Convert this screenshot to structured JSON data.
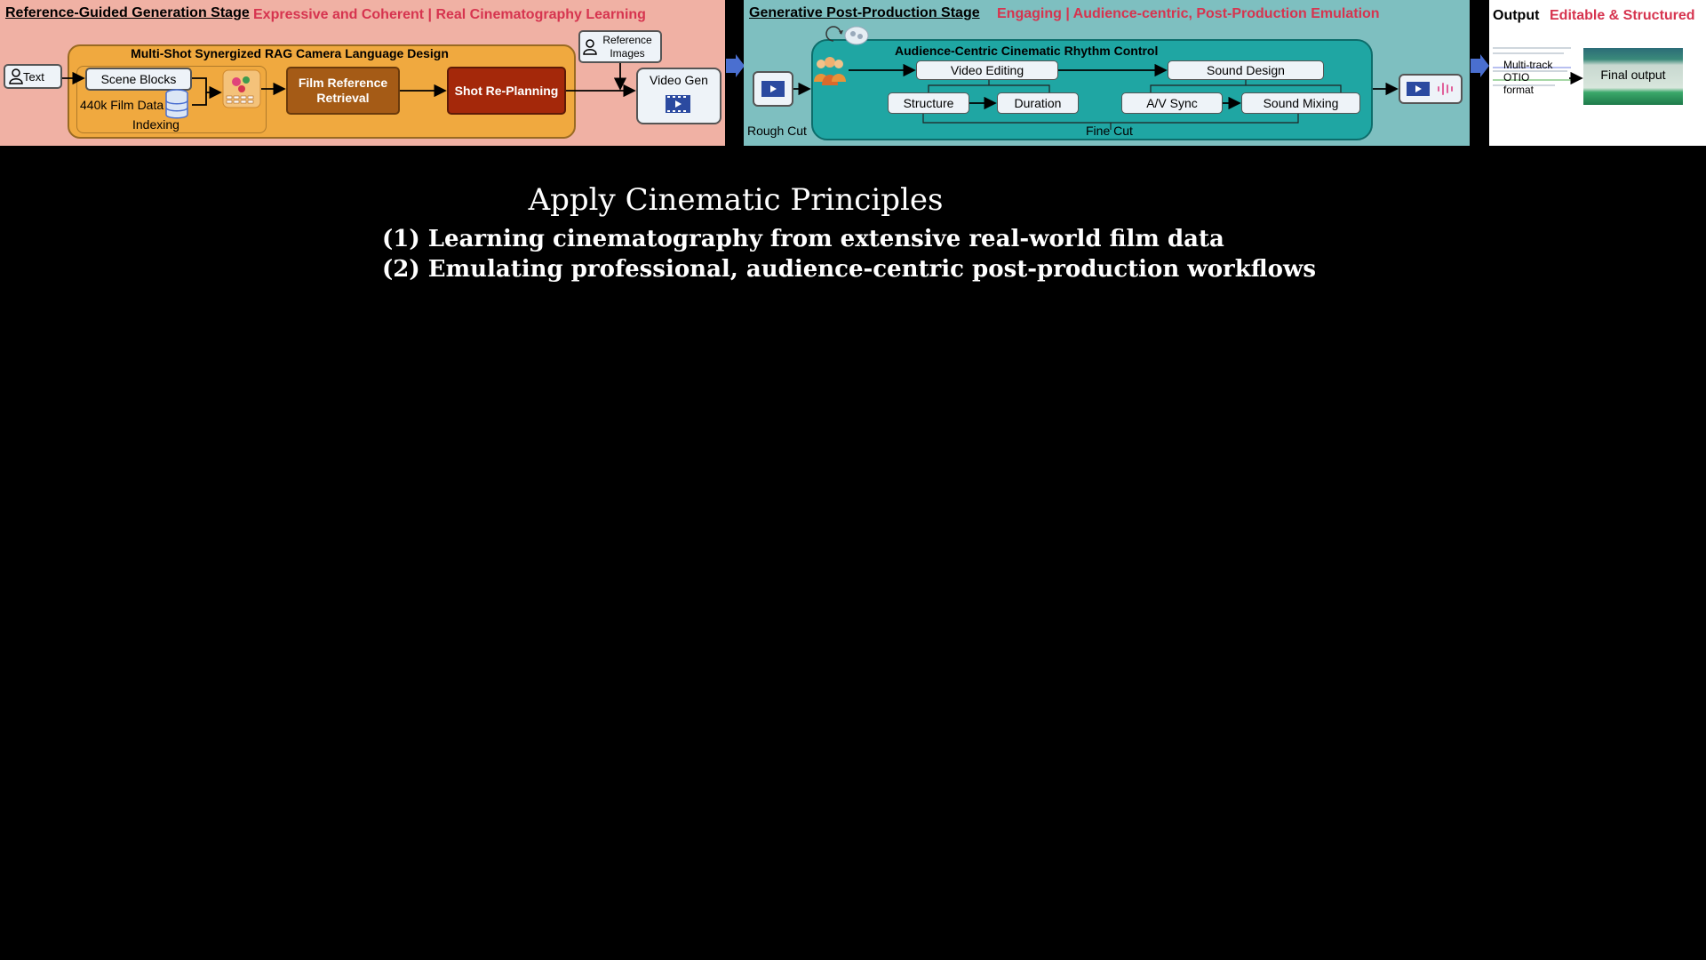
{
  "stage1": {
    "title": "Reference-Guided Generation Stage",
    "subtitle": "Expressive and Coherent | Real Cinematography Learning",
    "rag_title": "Multi-Shot Synergized RAG Camera Language Design",
    "text_input": "Text",
    "scene_blocks": "Scene Blocks",
    "film_data": "440k Film Data",
    "indexing": "Indexing",
    "film_reference_retrieval": "Film Reference Retrieval",
    "shot_replanning": "Shot Re-Planning",
    "reference_images": "Reference Images",
    "video_gen": "Video Gen"
  },
  "stage2": {
    "title": "Generative Post-Production Stage",
    "subtitle": "Engaging | Audience-centric, Post-Production Emulation",
    "rhythm_title": "Audience-Centric Cinematic Rhythm Control",
    "video_editing": "Video Editing",
    "sound_design": "Sound Design",
    "structure": "Structure",
    "duration": "Duration",
    "av_sync": "A/V Sync",
    "sound_mixing": "Sound Mixing",
    "rough_cut": "Rough Cut",
    "fine_cut": "Fine Cut"
  },
  "output": {
    "title": "Output",
    "subtitle": "Editable & Structured",
    "format_line1": "Multi-track",
    "format_line2": "OTIO",
    "format_line3": "format",
    "final_output": "Final output"
  },
  "principles": {
    "heading": "Apply Cinematic Principles",
    "point1": "(1) Learning cinematography from extensive real-world film data",
    "point2": "(2) Emulating professional, audience-centric post-production workflows"
  },
  "colors": {
    "stage1_bg": "#f0b1a4",
    "stage2_bg": "#7ebfc0",
    "rag_box": "#f0a93f",
    "rhythm_box": "#1fa6a3",
    "accent_red": "#d6344f",
    "connector_blue": "#4a6fd0"
  },
  "icons": [
    "person-icon",
    "database-icon",
    "retrieval-grid-icon",
    "video-icon",
    "audience-icon",
    "cycle-icon",
    "audio-wave-icon",
    "arrow-right-icon"
  ]
}
